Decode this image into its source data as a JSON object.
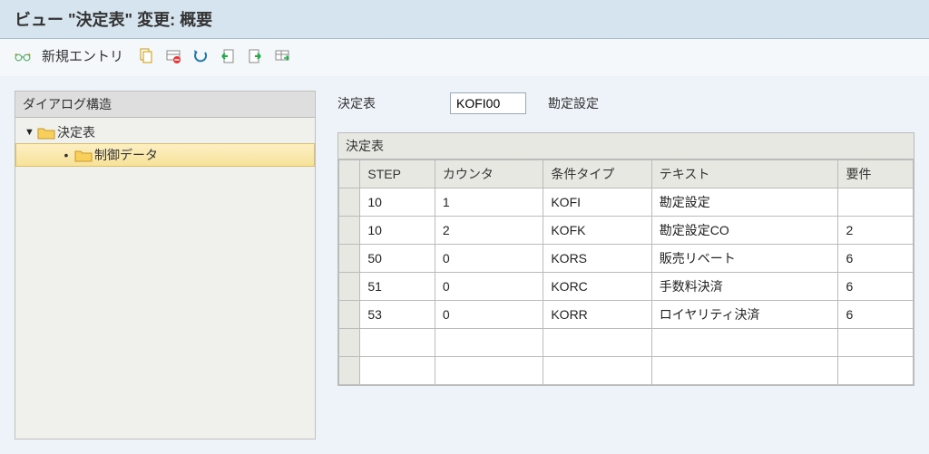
{
  "title": "ビュー \"決定表\" 変更: 概要",
  "toolbar": {
    "glasses_icon": "glasses-icon",
    "new_entry_label": "新規エントリ"
  },
  "tree": {
    "header": "ダイアログ構造",
    "node0": "決定表",
    "node1": "制御データ"
  },
  "header_line": {
    "label": "決定表",
    "value": "KOFI00",
    "desc": "勘定設定"
  },
  "grid": {
    "title": "決定表",
    "columns": {
      "step": "STEP",
      "counter": "カウンタ",
      "ctype": "条件タイプ",
      "text": "テキスト",
      "req": "要件"
    },
    "rows": [
      {
        "step": "10",
        "counter": "1",
        "ctype": "KOFI",
        "text": "勘定設定",
        "req": ""
      },
      {
        "step": "10",
        "counter": "2",
        "ctype": "KOFK",
        "text": "勘定設定CO",
        "req": "2"
      },
      {
        "step": "50",
        "counter": "0",
        "ctype": "KORS",
        "text": "販売リベート",
        "req": "6"
      },
      {
        "step": "51",
        "counter": "0",
        "ctype": "KORC",
        "text": "手数料決済",
        "req": "6"
      },
      {
        "step": "53",
        "counter": "0",
        "ctype": "KORR",
        "text": "ロイヤリティ決済",
        "req": "6"
      }
    ]
  }
}
